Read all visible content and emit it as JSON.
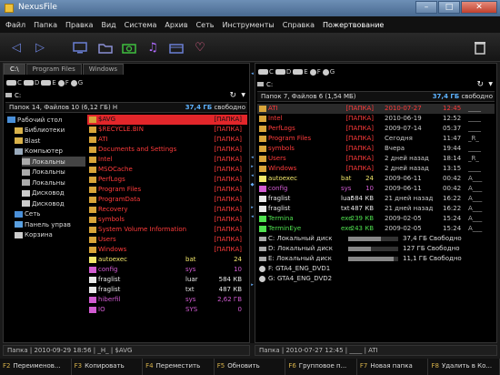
{
  "window": {
    "title": "NexusFile"
  },
  "menu": [
    "Файл",
    "Папка",
    "Правка",
    "Вид",
    "Система",
    "Архив",
    "Сеть",
    "Инструменты",
    "Справка",
    "Пожертвование"
  ],
  "toolbar": {
    "icons": [
      "back-arrow-icon",
      "forward-arrow-icon",
      "monitor-icon",
      "folder-icon",
      "camera-icon",
      "music-icon",
      "video-icon",
      "heart-icon",
      "trash-icon"
    ],
    "colors": {
      "icon": "#6a7fd4",
      "camera": "#3fbf3f",
      "music": "#b06bff",
      "heart": "#ff6a9a",
      "trash": "#cccccc"
    }
  },
  "left_panel": {
    "tabs": [
      "C:\\",
      "Program Files",
      "Windows"
    ],
    "drives": [
      "C",
      "D",
      "E",
      "F",
      "G"
    ],
    "path": "C:",
    "summary": {
      "text": "Папок 14, Файлов 10 (6,12 ГБ) H",
      "free": "37,4 ГБ",
      "free_label": "свободно"
    },
    "tree": [
      {
        "label": "Рабочий стол",
        "indent": 0,
        "icon": "desktop-icon"
      },
      {
        "label": "Библиотеки",
        "indent": 1,
        "icon": "library-icon"
      },
      {
        "label": "Blast",
        "indent": 1,
        "icon": "user-folder-icon"
      },
      {
        "label": "Компьютер",
        "indent": 1,
        "icon": "computer-icon"
      },
      {
        "label": "Локальны",
        "indent": 2,
        "icon": "disk-icon",
        "selected": true
      },
      {
        "label": "Локальны",
        "indent": 2,
        "icon": "disk-icon"
      },
      {
        "label": "Локальны",
        "indent": 2,
        "icon": "disk-icon"
      },
      {
        "label": "Дисковод",
        "indent": 2,
        "icon": "dvd-icon"
      },
      {
        "label": "Дисковод",
        "indent": 2,
        "icon": "dvd-icon"
      },
      {
        "label": "Сеть",
        "indent": 1,
        "icon": "network-icon"
      },
      {
        "label": "Панель управ",
        "indent": 1,
        "icon": "control-panel-icon"
      },
      {
        "label": "Корзина",
        "indent": 1,
        "icon": "recycle-bin-icon"
      }
    ],
    "files": [
      {
        "name": "$AVG",
        "ext": "",
        "size": "[ПАПКА]",
        "color": "#ff5555",
        "kind": "folder",
        "selected": true
      },
      {
        "name": "$RECYCLE.BIN",
        "ext": "",
        "size": "[ПАПКА]",
        "color": "#ff3b3b",
        "kind": "folder"
      },
      {
        "name": "ATI",
        "ext": "",
        "size": "[ПАПКА]",
        "color": "#ff3b3b",
        "kind": "folder"
      },
      {
        "name": "Documents and Settings",
        "ext": "",
        "size": "[ПАПКА]",
        "color": "#ff3b3b",
        "kind": "folder"
      },
      {
        "name": "Intel",
        "ext": "",
        "size": "[ПАПКА]",
        "color": "#ff3b3b",
        "kind": "folder"
      },
      {
        "name": "MSOCache",
        "ext": "",
        "size": "[ПАПКА]",
        "color": "#ff3b3b",
        "kind": "folder"
      },
      {
        "name": "PerfLogs",
        "ext": "",
        "size": "[ПАПКА]",
        "color": "#ff3b3b",
        "kind": "folder"
      },
      {
        "name": "Program Files",
        "ext": "",
        "size": "[ПАПКА]",
        "color": "#ff3b3b",
        "kind": "folder"
      },
      {
        "name": "ProgramData",
        "ext": "",
        "size": "[ПАПКА]",
        "color": "#ff3b3b",
        "kind": "folder"
      },
      {
        "name": "Recovery",
        "ext": "",
        "size": "[ПАПКА]",
        "color": "#ff3b3b",
        "kind": "folder"
      },
      {
        "name": "symbols",
        "ext": "",
        "size": "[ПАПКА]",
        "color": "#ff3b3b",
        "kind": "folder"
      },
      {
        "name": "System Volume Information",
        "ext": "",
        "size": "[ПАПКА]",
        "color": "#ff3b3b",
        "kind": "folder"
      },
      {
        "name": "Users",
        "ext": "",
        "size": "[ПАПКА]",
        "color": "#ff3b3b",
        "kind": "folder"
      },
      {
        "name": "Windows",
        "ext": "",
        "size": "[ПАПКА]",
        "color": "#ff3b3b",
        "kind": "folder"
      },
      {
        "name": "autoexec",
        "ext": "bat",
        "size": "24",
        "color": "#f2e76a",
        "kind": "file"
      },
      {
        "name": "config",
        "ext": "sys",
        "size": "10",
        "color": "#d15bd1",
        "kind": "file"
      },
      {
        "name": "fraglist",
        "ext": "luar",
        "size": "584 КВ",
        "color": "#e8e8e8",
        "kind": "file"
      },
      {
        "name": "fraglist",
        "ext": "txt",
        "size": "487 КВ",
        "color": "#e8e8e8",
        "kind": "file"
      },
      {
        "name": "hiberfil",
        "ext": "sys",
        "size": "2,62 ГВ",
        "color": "#d15bd1",
        "kind": "file"
      },
      {
        "name": "IO",
        "ext": "SYS",
        "size": "0",
        "color": "#d15bd1",
        "kind": "file"
      }
    ],
    "status": "Папка | 2010-09-29 18:56 | _H_ | $AVG"
  },
  "right_panel": {
    "drives": [
      "C",
      "D",
      "E",
      "F",
      "G"
    ],
    "path": "C:",
    "summary": {
      "text": "Папок 7, Файлов 6 (1,54 МБ)",
      "free": "37,4 ГБ",
      "free_label": "свободно"
    },
    "files": [
      {
        "name": "ATI",
        "ext": "",
        "size": "[ПАПКА]",
        "date": "2010-07-27",
        "time": "12:45",
        "attr": "____",
        "color": "#ff3b3b",
        "kind": "folder",
        "selected": true
      },
      {
        "name": "Intel",
        "ext": "",
        "size": "[ПАПКА]",
        "date": "2010-06-19",
        "time": "12:52",
        "attr": "____",
        "color": "#ff3b3b",
        "kind": "folder"
      },
      {
        "name": "PerfLogs",
        "ext": "",
        "size": "[ПАПКА]",
        "date": "2009-07-14",
        "time": "05:37",
        "attr": "____",
        "color": "#ff3b3b",
        "kind": "folder"
      },
      {
        "name": "Program Files",
        "ext": "",
        "size": "[ПАПКА]",
        "date": "Сегодня",
        "time": "11:47",
        "attr": "_R_",
        "color": "#ff3b3b",
        "kind": "folder"
      },
      {
        "name": "symbols",
        "ext": "",
        "size": "[ПАПКА]",
        "date": "Вчера",
        "time": "19:44",
        "attr": "____",
        "color": "#ff3b3b",
        "kind": "folder"
      },
      {
        "name": "Users",
        "ext": "",
        "size": "[ПАПКА]",
        "date": "2 дней назад",
        "time": "18:14",
        "attr": "_R_",
        "color": "#ff3b3b",
        "kind": "folder"
      },
      {
        "name": "Windows",
        "ext": "",
        "size": "[ПАПКА]",
        "date": "2 дней назад",
        "time": "13:15",
        "attr": "____",
        "color": "#ff3b3b",
        "kind": "folder"
      },
      {
        "name": "autoexec",
        "ext": "bat",
        "size": "24",
        "date": "2009-06-11",
        "time": "00:42",
        "attr": "A___",
        "color": "#f2e76a",
        "kind": "file"
      },
      {
        "name": "config",
        "ext": "sys",
        "size": "10",
        "date": "2009-06-11",
        "time": "00:42",
        "attr": "A___",
        "color": "#d15bd1",
        "kind": "file"
      },
      {
        "name": "fraglist",
        "ext": "luar",
        "size": "584 КВ",
        "date": "21 дней назад",
        "time": "16:22",
        "attr": "A___",
        "color": "#e8e8e8",
        "kind": "file"
      },
      {
        "name": "fraglist",
        "ext": "txt",
        "size": "487 КВ",
        "date": "21 дней назад",
        "time": "16:22",
        "attr": "A___",
        "color": "#e8e8e8",
        "kind": "file"
      },
      {
        "name": "Termina",
        "ext": "exe",
        "size": "239 КВ",
        "date": "2009-02-05",
        "time": "15:24",
        "attr": "A___",
        "color": "#4fe04f",
        "kind": "file"
      },
      {
        "name": "TerminEye",
        "ext": "exe",
        "size": "243 КВ",
        "date": "2009-02-05",
        "time": "15:24",
        "attr": "A___",
        "color": "#4fe04f",
        "kind": "file"
      },
      {
        "name": "C: Локальный диск",
        "ext": "",
        "size": "37,4 ГБ Свободно",
        "color": "#dcdcdc",
        "kind": "drive",
        "used": 0.65
      },
      {
        "name": "D: Локальный диск",
        "ext": "",
        "size": "127 ГБ Свободно",
        "color": "#dcdcdc",
        "kind": "drive",
        "used": 0.45
      },
      {
        "name": "E: Локальный диск",
        "ext": "",
        "size": "11,1 ГБ Свободно",
        "color": "#dcdcdc",
        "kind": "drive",
        "used": 0.9
      },
      {
        "name": "F: GTA4_ENG_DVD1",
        "ext": "",
        "size": "",
        "color": "#dcdcdc",
        "kind": "dvd"
      },
      {
        "name": "G: GTA4_ENG_DVD2",
        "ext": "",
        "size": "",
        "color": "#dcdcdc",
        "kind": "dvd"
      }
    ],
    "status": "Папка | 2010-07-27 12:45 | ____ | ATI"
  },
  "function_keys": [
    {
      "key": "F2",
      "label": "Переименов..."
    },
    {
      "key": "F3",
      "label": "Копировать"
    },
    {
      "key": "F4",
      "label": "Переместить"
    },
    {
      "key": "F5",
      "label": "Обновить"
    },
    {
      "key": "F6",
      "label": "Групповое п..."
    },
    {
      "key": "F7",
      "label": "Новая папка"
    },
    {
      "key": "F8",
      "label": "Удалить в Ко..."
    }
  ]
}
